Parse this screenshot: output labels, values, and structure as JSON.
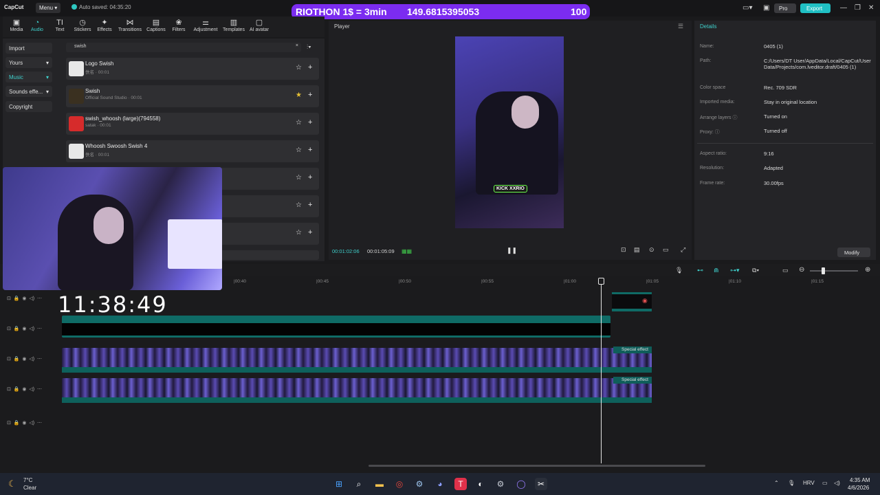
{
  "app": {
    "logo": "CapCut",
    "menu_label": "Menu",
    "autosave": "Auto saved: 04:35:20",
    "pro_label": "Pro",
    "export_label": "Export",
    "window_controls": [
      "minimize-icon",
      "maximize-icon",
      "close-icon"
    ]
  },
  "overlay": {
    "banner_title": "RIOTHON 1$ = 3min",
    "banner_value": "149.6815395053",
    "banner_count": "100",
    "banner_color": "#7b2cf0",
    "stream_clock": "11:38:49",
    "kick_tag": "KICK XXRIO"
  },
  "tools": [
    {
      "label": "Media",
      "icon": "media-icon"
    },
    {
      "label": "Audio",
      "icon": "audio-icon"
    },
    {
      "label": "Text",
      "icon": "text-icon"
    },
    {
      "label": "Stickers",
      "icon": "stickers-icon"
    },
    {
      "label": "Effects",
      "icon": "effects-icon"
    },
    {
      "label": "Transitions",
      "icon": "transitions-icon"
    },
    {
      "label": "Captions",
      "icon": "captions-icon"
    },
    {
      "label": "Filters",
      "icon": "filters-icon"
    },
    {
      "label": "Adjustment",
      "icon": "adjustment-icon"
    },
    {
      "label": "Templates",
      "icon": "templates-icon"
    },
    {
      "label": "AI avatar",
      "icon": "ai-avatar-icon"
    }
  ],
  "left_nav": [
    "Import",
    "Yours",
    "Music",
    "Sounds effe...",
    "Copyright"
  ],
  "search": {
    "value": "swish"
  },
  "sounds": [
    {
      "name": "Logo Swish",
      "sub": "佚名 · 00:01",
      "favorited": false
    },
    {
      "name": "Swish",
      "sub": "Official Sound Studio · 00:01",
      "favorited": true
    },
    {
      "name": "swish_whoosh (large)(794558)",
      "sub": "satak · 00:01",
      "favorited": false
    },
    {
      "name": "Whoosh Swoosh Swish 4",
      "sub": "佚名 · 00:01",
      "favorited": false
    }
  ],
  "player": {
    "title": "Player",
    "current_time": "00:01:02:06",
    "total_time": "00:01:05:09"
  },
  "details": {
    "title": "Details",
    "rows": [
      {
        "key": "Name:",
        "value": "0405 (1)"
      },
      {
        "key": "Path:",
        "value": "C:/Users/DT User/AppData/Local/CapCut/User Data/Projects/com.lveditor.draft/0405 (1)"
      },
      {
        "key": "Color space",
        "value": "Rec. 709 SDR"
      },
      {
        "key": "Imported media:",
        "value": "Stay in original location"
      },
      {
        "key": "Arrange layers",
        "value": "Turned on"
      },
      {
        "key": "Proxy:",
        "value": "Turned off"
      },
      {
        "key": "Aspect ratio:",
        "value": "9:16"
      },
      {
        "key": "Resolution:",
        "value": "Adapted"
      },
      {
        "key": "Frame rate:",
        "value": "30.00fps"
      }
    ],
    "modify_label": "Modify"
  },
  "timeline": {
    "ruler": [
      "|00:40",
      "|00:45",
      "|00:50",
      "|00:55",
      "|01:00",
      "|01:05",
      "|01:10",
      "|01:15"
    ],
    "effect_label": "Special effect"
  },
  "taskbar": {
    "temp": "7°C",
    "weather": "Clear",
    "lang": "HRV",
    "time": "4:35 AM",
    "date": "4/6/2026"
  }
}
